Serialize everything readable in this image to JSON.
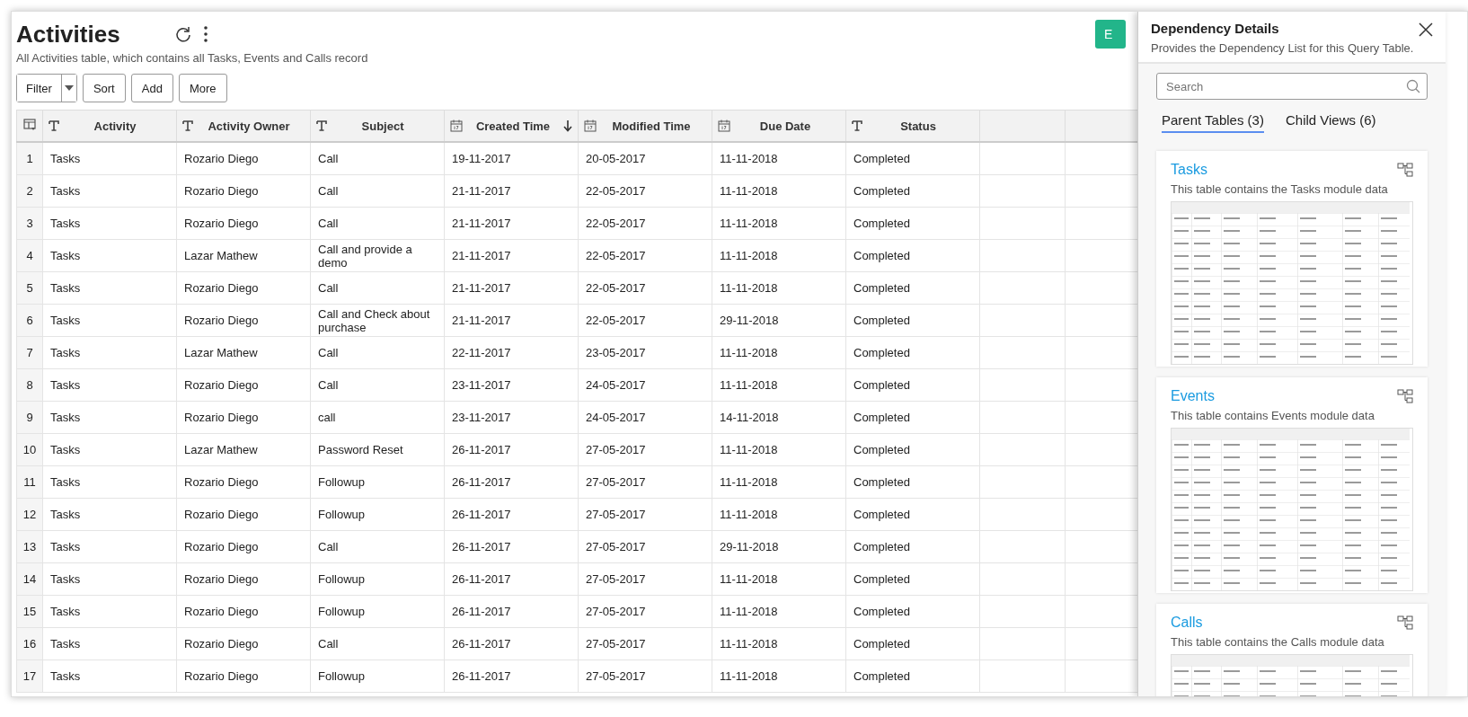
{
  "header": {
    "title": "Activities",
    "description": "All Activities table, which contains all Tasks, Events and Calls record"
  },
  "toolbar": {
    "filter": "Filter",
    "buttons": [
      "Sort",
      "Add",
      "More"
    ]
  },
  "cut_button": {
    "label": "E"
  },
  "table": {
    "columns": [
      {
        "label": "Activity",
        "kind": "text",
        "sorted": false
      },
      {
        "label": "Activity Owner",
        "kind": "text",
        "sorted": false
      },
      {
        "label": "Subject",
        "kind": "text",
        "sorted": false
      },
      {
        "label": "Created Time",
        "kind": "date",
        "sorted": true
      },
      {
        "label": "Modified Time",
        "kind": "date",
        "sorted": false
      },
      {
        "label": "Due Date",
        "kind": "date",
        "sorted": false
      },
      {
        "label": "Status",
        "kind": "text",
        "sorted": false
      }
    ],
    "rows": [
      {
        "number": "1",
        "cells": [
          "Tasks",
          "Rozario Diego",
          "Call",
          "19-11-2017",
          "20-05-2017",
          "11-11-2018",
          "Completed"
        ]
      },
      {
        "number": "2",
        "cells": [
          "Tasks",
          "Rozario Diego",
          "Call",
          "21-11-2017",
          "22-05-2017",
          "11-11-2018",
          "Completed"
        ]
      },
      {
        "number": "3",
        "cells": [
          "Tasks",
          "Rozario Diego",
          "Call",
          "21-11-2017",
          "22-05-2017",
          "11-11-2018",
          "Completed"
        ]
      },
      {
        "number": "4",
        "cells": [
          "Tasks",
          "Lazar Mathew",
          "Call and provide a demo",
          "21-11-2017",
          "22-05-2017",
          "11-11-2018",
          "Completed"
        ]
      },
      {
        "number": "5",
        "cells": [
          "Tasks",
          "Rozario Diego",
          "Call",
          "21-11-2017",
          "22-05-2017",
          "11-11-2018",
          "Completed"
        ]
      },
      {
        "number": "6",
        "cells": [
          "Tasks",
          "Rozario Diego",
          "Call and Check about purchase",
          "21-11-2017",
          "22-05-2017",
          "29-11-2018",
          "Completed"
        ]
      },
      {
        "number": "7",
        "cells": [
          "Tasks",
          "Lazar Mathew",
          "Call",
          "22-11-2017",
          "23-05-2017",
          "11-11-2018",
          "Completed"
        ]
      },
      {
        "number": "8",
        "cells": [
          "Tasks",
          "Rozario Diego",
          "Call",
          "23-11-2017",
          "24-05-2017",
          "11-11-2018",
          "Completed"
        ]
      },
      {
        "number": "9",
        "cells": [
          "Tasks",
          "Rozario Diego",
          "call",
          "23-11-2017",
          "24-05-2017",
          "14-11-2018",
          "Completed"
        ]
      },
      {
        "number": "10",
        "cells": [
          "Tasks",
          "Lazar Mathew",
          "Password Reset",
          "26-11-2017",
          "27-05-2017",
          "11-11-2018",
          "Completed"
        ]
      },
      {
        "number": "11",
        "cells": [
          "Tasks",
          "Rozario Diego",
          "Followup",
          "26-11-2017",
          "27-05-2017",
          "11-11-2018",
          "Completed"
        ]
      },
      {
        "number": "12",
        "cells": [
          "Tasks",
          "Rozario Diego",
          "Followup",
          "26-11-2017",
          "27-05-2017",
          "11-11-2018",
          "Completed"
        ]
      },
      {
        "number": "13",
        "cells": [
          "Tasks",
          "Rozario Diego",
          "Call",
          "26-11-2017",
          "27-05-2017",
          "29-11-2018",
          "Completed"
        ]
      },
      {
        "number": "14",
        "cells": [
          "Tasks",
          "Rozario Diego",
          "Followup",
          "26-11-2017",
          "27-05-2017",
          "11-11-2018",
          "Completed"
        ]
      },
      {
        "number": "15",
        "cells": [
          "Tasks",
          "Rozario Diego",
          "Followup",
          "26-11-2017",
          "27-05-2017",
          "11-11-2018",
          "Completed"
        ]
      },
      {
        "number": "16",
        "cells": [
          "Tasks",
          "Rozario Diego",
          "Call",
          "26-11-2017",
          "27-05-2017",
          "11-11-2018",
          "Completed"
        ]
      },
      {
        "number": "17",
        "cells": [
          "Tasks",
          "Rozario Diego",
          "Followup",
          "26-11-2017",
          "27-05-2017",
          "11-11-2018",
          "Completed"
        ]
      }
    ]
  },
  "panel": {
    "title": "Dependency Details",
    "subtitle": "Provides the Dependency List for this Query Table.",
    "search": {
      "placeholder": "Search"
    },
    "tabs": [
      {
        "label": "Parent Tables (3)",
        "selected": true
      },
      {
        "label": "Child Views (6)",
        "selected": false
      }
    ],
    "cards": [
      {
        "title": "Tasks",
        "description": "This table contains the Tasks module data"
      },
      {
        "title": "Events",
        "description": "This table contains Events module data"
      },
      {
        "title": "Calls",
        "description": "This table contains the Calls module data"
      }
    ]
  }
}
